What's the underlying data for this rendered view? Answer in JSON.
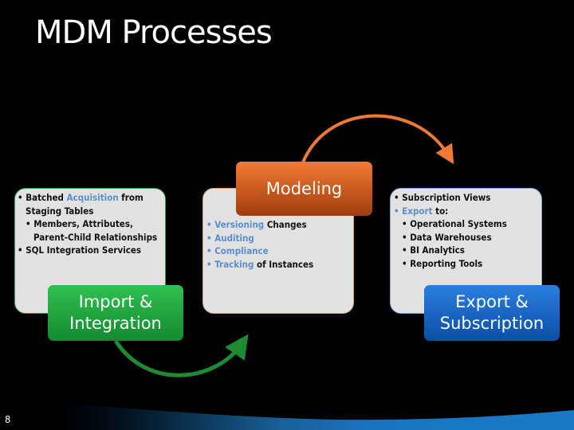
{
  "slide": {
    "title": "MDM Processes",
    "page_number": "8"
  },
  "stages": [
    {
      "name": "Import & Integration",
      "line1": "Import &",
      "line2": "Integration",
      "color": "#1fa53e",
      "bullets": [
        {
          "level": 1,
          "parts": [
            {
              "t": "Batched ",
              "hl": false
            },
            {
              "t": "Acquisition",
              "hl": true
            },
            {
              "t": " from",
              "hl": false
            }
          ],
          "cont": "Staging Tables"
        },
        {
          "level": 2,
          "parts": [
            {
              "t": "Members, Attributes,",
              "hl": false
            }
          ],
          "cont": "Parent-Child Relationships"
        },
        {
          "level": 1,
          "parts": [
            {
              "t": "SQL Integration Services",
              "hl": false
            }
          ]
        }
      ]
    },
    {
      "name": "Modeling",
      "line1": "Modeling",
      "color": "#e06420",
      "bullets": [
        {
          "level": 1,
          "parts": [
            {
              "t": "Versioning",
              "hl": true
            },
            {
              "t": " Changes",
              "hl": false
            }
          ]
        },
        {
          "level": 1,
          "parts": [
            {
              "t": "Auditing",
              "hl": true
            }
          ]
        },
        {
          "level": 1,
          "parts": [
            {
              "t": "Compliance",
              "hl": true
            }
          ]
        },
        {
          "level": 1,
          "parts": [
            {
              "t": "Tracking",
              "hl": true
            },
            {
              "t": " of Instances",
              "hl": false
            }
          ]
        }
      ]
    },
    {
      "name": "Export & Subscription",
      "line1": "Export &",
      "line2": "Subscription",
      "color": "#1565c9",
      "bullets": [
        {
          "level": 1,
          "parts": [
            {
              "t": "Subscription Views",
              "hl": false
            }
          ]
        },
        {
          "level": 1,
          "parts": [
            {
              "t": "Export",
              "hl": true
            },
            {
              "t": " to:",
              "hl": false
            }
          ]
        },
        {
          "level": 2,
          "parts": [
            {
              "t": "Operational Systems",
              "hl": false
            }
          ]
        },
        {
          "level": 2,
          "parts": [
            {
              "t": "Data Warehouses",
              "hl": false
            }
          ]
        },
        {
          "level": 2,
          "parts": [
            {
              "t": "BI Analytics",
              "hl": false
            }
          ]
        },
        {
          "level": 2,
          "parts": [
            {
              "t": "Reporting Tools",
              "hl": false
            }
          ]
        }
      ]
    }
  ],
  "colors": {
    "highlight": "#5b8fd0",
    "green_arrow": "#1e8a34",
    "orange_arrow": "#ee7a35",
    "footer_wave": "#1874c0"
  }
}
